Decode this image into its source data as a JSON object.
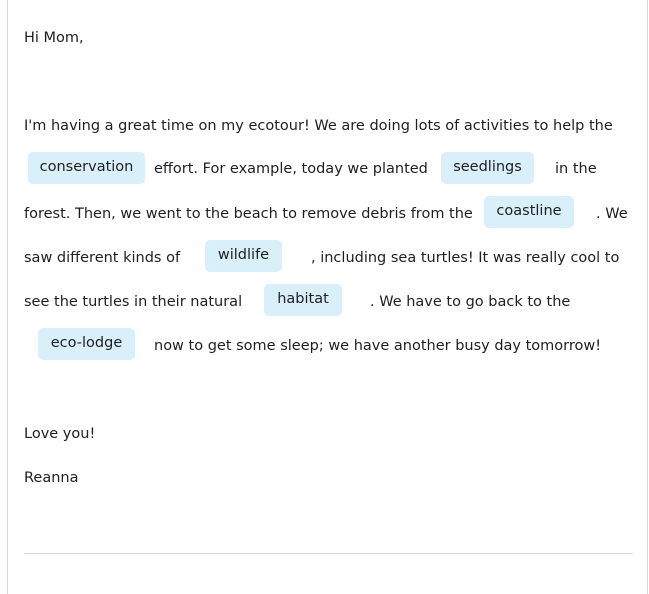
{
  "letter": {
    "greeting": "Hi Mom,",
    "p1_line1": "I'm having a great time on my ecotour! We are doing lots of activities to help the",
    "p1_after_conservation": "effort. For example, today we planted",
    "p1_after_seedlings": "in the",
    "p1_line3_start": "forest. Then, we went to the beach to remove debris from the",
    "p1_after_coastline": ". We",
    "p1_line4_start": "saw different kinds of",
    "p1_after_wildlife": ", including sea turtles! It was really cool to",
    "p1_line5_start": "see the turtles in their natural",
    "p1_after_habitat": ". We have to go back to the",
    "p1_after_ecolodge": "now to get some sleep; we have another busy day tomorrow!",
    "closing": "Love you!",
    "signature": "Reanna"
  },
  "answers": {
    "conservation": "conservation",
    "seedlings": "seedlings",
    "coastline": "coastline",
    "wildlife": "wildlife",
    "habitat": "habitat",
    "eco_lodge": "eco-lodge"
  }
}
